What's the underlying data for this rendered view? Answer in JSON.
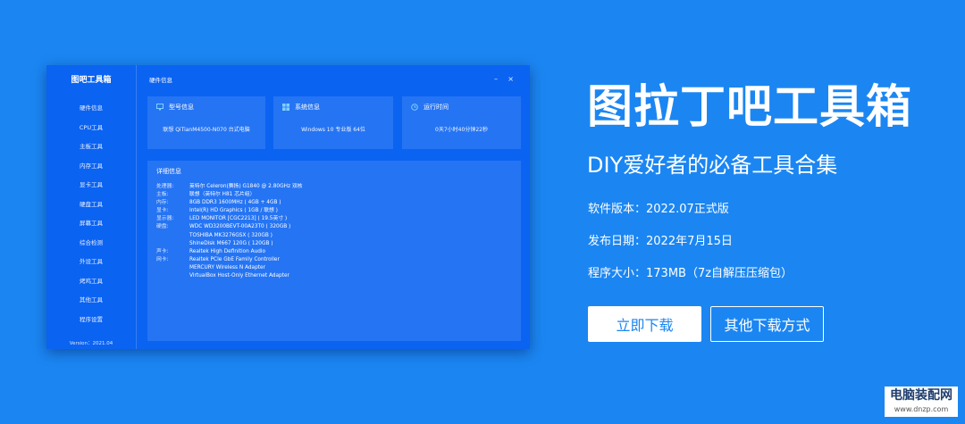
{
  "app": {
    "brand": "图吧工具箱",
    "window_title": "硬件信息",
    "version": "Version：2021.04",
    "nav": [
      "硬件信息",
      "CPU工具",
      "主板工具",
      "内存工具",
      "显卡工具",
      "硬盘工具",
      "屏幕工具",
      "综合检测",
      "外设工具",
      "烤鸡工具",
      "其他工具",
      "程序设置"
    ],
    "cards": {
      "model_title": "型号信息",
      "model_value": "联想 QiTianM4500-N070 台式电脑",
      "sys_title": "系统信息",
      "sys_value": "Windows 10 专业版 64位",
      "time_title": "运行时间",
      "time_value": "0天7小时40分钟22秒"
    },
    "detail": {
      "title": "详细信息",
      "rows": [
        {
          "k": "处理器:",
          "v": "英特尔 Celeron(赛扬) G1840 @ 2.80GHz 双核"
        },
        {
          "k": "主板:",
          "v": "联想（英特尔 H81 芯片组）"
        },
        {
          "k": "内存:",
          "v": "8GB DDR3 1600MHz ( 4GB + 4GB )"
        },
        {
          "k": "显卡:",
          "v": "Intel(R) HD Graphics ( 1GB / 联想 )"
        },
        {
          "k": "显示器:",
          "v": "LED MONITOR [CGC2213] ( 19.5英寸 )"
        },
        {
          "k": "硬盘:",
          "v": "WDC WD3200BEVT-00A23T0 ( 320GB )"
        },
        {
          "k": "",
          "v": "TOSHIBA MK3276GSX ( 320GB )"
        },
        {
          "k": "",
          "v": "ShineDisk M667 120G ( 120GB )"
        },
        {
          "k": "声卡:",
          "v": "Realtek High Definition Audio"
        },
        {
          "k": "网卡:",
          "v": "Realtek PCIe GbE Family Controller"
        },
        {
          "k": "",
          "v": "MERCURY Wireless N Adapter"
        },
        {
          "k": "",
          "v": "VirtualBox Host-Only Ethernet Adapter"
        }
      ]
    },
    "controls": {
      "minimize": "–",
      "close": "×"
    }
  },
  "hero": {
    "title": "图拉丁吧工具箱",
    "subtitle": "DIY爱好者的必备工具合集",
    "version_line": "软件版本：2022.07正式版",
    "date_line": "发布日期：2022年7月15日",
    "size_line": "程序大小：173MB（7z自解压压缩包）",
    "download_btn": "立即下载",
    "other_btn": "其他下载方式"
  },
  "watermark": {
    "cn": "电脑装配网",
    "url": "www.dnzp.com"
  },
  "colors": {
    "background": "#1b86f2",
    "window": "#0b63f2",
    "button_text": "#1b86f2"
  }
}
